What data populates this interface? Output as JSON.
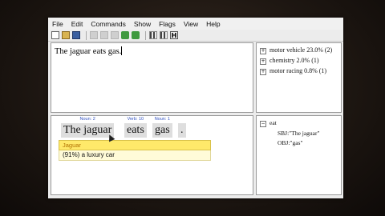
{
  "menu": {
    "items": [
      "File",
      "Edit",
      "Commands",
      "Show",
      "Flags",
      "View",
      "Help"
    ]
  },
  "toolbar": {
    "icons": [
      "new-document-icon",
      "open-folder-icon",
      "save-icon",
      "cut-icon",
      "copy-icon",
      "paste-icon",
      "analyze-icon",
      "run-icon",
      "columns-icon",
      "bars-icon",
      "header-icon"
    ],
    "header_glyph": "H"
  },
  "editor": {
    "text": "The jaguar eats gas."
  },
  "categories": {
    "items": [
      {
        "label": "motor vehicle 23.0% (2)"
      },
      {
        "label": "chemistry 2.0% (1)"
      },
      {
        "label": "motor racing 0.8% (1)"
      }
    ]
  },
  "parse": {
    "tokens": [
      {
        "tag": "Noun: 2",
        "word": "The jaguar"
      },
      {
        "tag": "Verb: 10",
        "word": "eats"
      },
      {
        "tag": "Noun: 1",
        "word": "gas"
      },
      {
        "tag": "",
        "word": "."
      }
    ],
    "sense_header": "Jaguar",
    "sense_option": "(91%) a luxury car"
  },
  "frame": {
    "root": "eat",
    "subject": "SBJ:\"The jaguar\"",
    "object": "OBJ:\"gas\""
  },
  "colors": {
    "sense_header_bg": "#ffe96a",
    "tag_text": "#3050c0"
  }
}
